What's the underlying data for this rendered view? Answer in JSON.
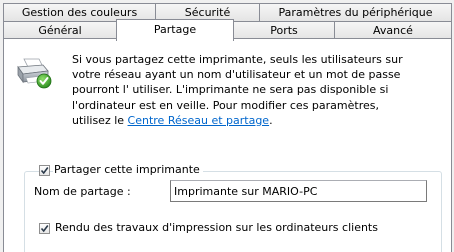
{
  "tabs_back": [
    {
      "label": "Gestion des couleurs"
    },
    {
      "label": "Sécurité"
    },
    {
      "label": "Paramètres du périphérique"
    }
  ],
  "tabs_front": [
    {
      "label": "Général"
    },
    {
      "label": "Partage"
    },
    {
      "label": "Ports"
    },
    {
      "label": "Avancé"
    }
  ],
  "active_tab": "Partage",
  "info": {
    "text": "Si vous partagez cette imprimante, seuls les utilisateurs sur votre réseau ayant un nom d'utilisateur et un mot de passe pourront l' utiliser. L'imprimante ne sera pas disponible si l'ordinateur est en veille. Pour modifier ces paramètres, utilisez le ",
    "link": "Centre Réseau et partage",
    "after": "."
  },
  "share_checkbox": {
    "label": "Partager cette imprimante",
    "checked": true
  },
  "share_name": {
    "label": "Nom de partage :",
    "value": "Imprimante sur MARIO-PC"
  },
  "render_checkbox": {
    "label": "Rendu des travaux d'impression sur les ordinateurs clients",
    "checked": true
  },
  "colors": {
    "link": "#0066cc",
    "tab_border": "#898c95",
    "groupbox_border": "#d5dfe5"
  },
  "icons": {
    "printer": "shared-printer-icon",
    "check": "checkmark-icon"
  }
}
